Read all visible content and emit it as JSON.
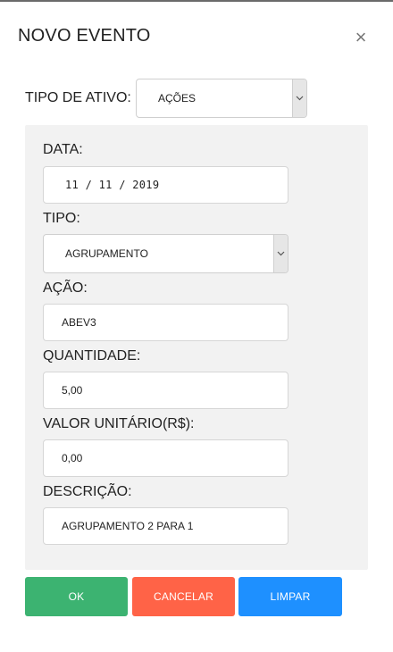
{
  "modal": {
    "title": "NOVO EVENTO",
    "close_glyph": "×"
  },
  "asset_type": {
    "label": "TIPO DE ATIVO:",
    "selected": "AÇÕES"
  },
  "form": {
    "date": {
      "label": "DATA:",
      "value": "11 / 11 / 2019"
    },
    "type": {
      "label": "TIPO:",
      "selected": "AGRUPAMENTO"
    },
    "action": {
      "label": "AÇÃO:",
      "value": "ABEV3"
    },
    "quantity": {
      "label": "QUANTIDADE:",
      "value": "5,00"
    },
    "unit_value": {
      "label": "VALOR UNITÁRIO(R$):",
      "value": "0,00"
    },
    "description": {
      "label": "DESCRIÇÃO:",
      "value": "AGRUPAMENTO 2 PARA 1"
    }
  },
  "buttons": {
    "ok": "OK",
    "cancel": "CANCELAR",
    "clear": "LIMPAR"
  },
  "colors": {
    "ok": "#3cb371",
    "cancel": "#ff6347",
    "clear": "#1e90ff",
    "panel": "#f2f2f2"
  },
  "icons": {
    "close": "close-icon",
    "dropdown": "chevron-down-icon"
  }
}
